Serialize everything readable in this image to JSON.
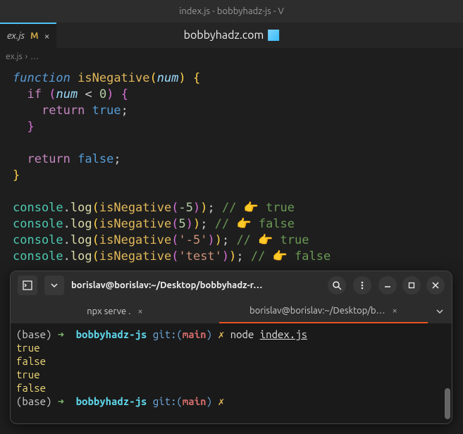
{
  "titlebar": "index.js - bobbyhadz-js - V",
  "tab": {
    "name": "ex.js",
    "modified": "M",
    "close": "×"
  },
  "watermark": "bobbyhadz.com",
  "breadcrumb": {
    "file": "ex.js",
    "sep": "›",
    "more": "…"
  },
  "code": {
    "func_kw": "function",
    "fn_name": "isNegative",
    "param": "num",
    "if_kw": "if",
    "lt": "<",
    "zero": "0",
    "return_kw": "return",
    "true_kw": "true",
    "false_kw": "false",
    "console": "console",
    "log": "log",
    "neg5": "-5",
    "pos5": "5",
    "str_neg5": "'-5'",
    "str_test": "'test'",
    "c_true": "// 👉️ true",
    "c_false": "// 👉️ false"
  },
  "terminal": {
    "title": "borislav@borislav:~/Desktop/bobbyhadz-r…",
    "tabs": {
      "t1": "npx serve .",
      "t2": "borislav@borislav:~/Desktop/b…"
    },
    "prompt": {
      "base": "(base)",
      "arrow": "➜",
      "dir": "bobbyhadz-js",
      "git": "git:(",
      "branch": "main",
      "gitclose": ")",
      "x": "✗",
      "cmd_node": "node",
      "cmd_file": "index.js"
    },
    "output": {
      "l1": "true",
      "l2": "false",
      "l3": "true",
      "l4": "false"
    }
  }
}
